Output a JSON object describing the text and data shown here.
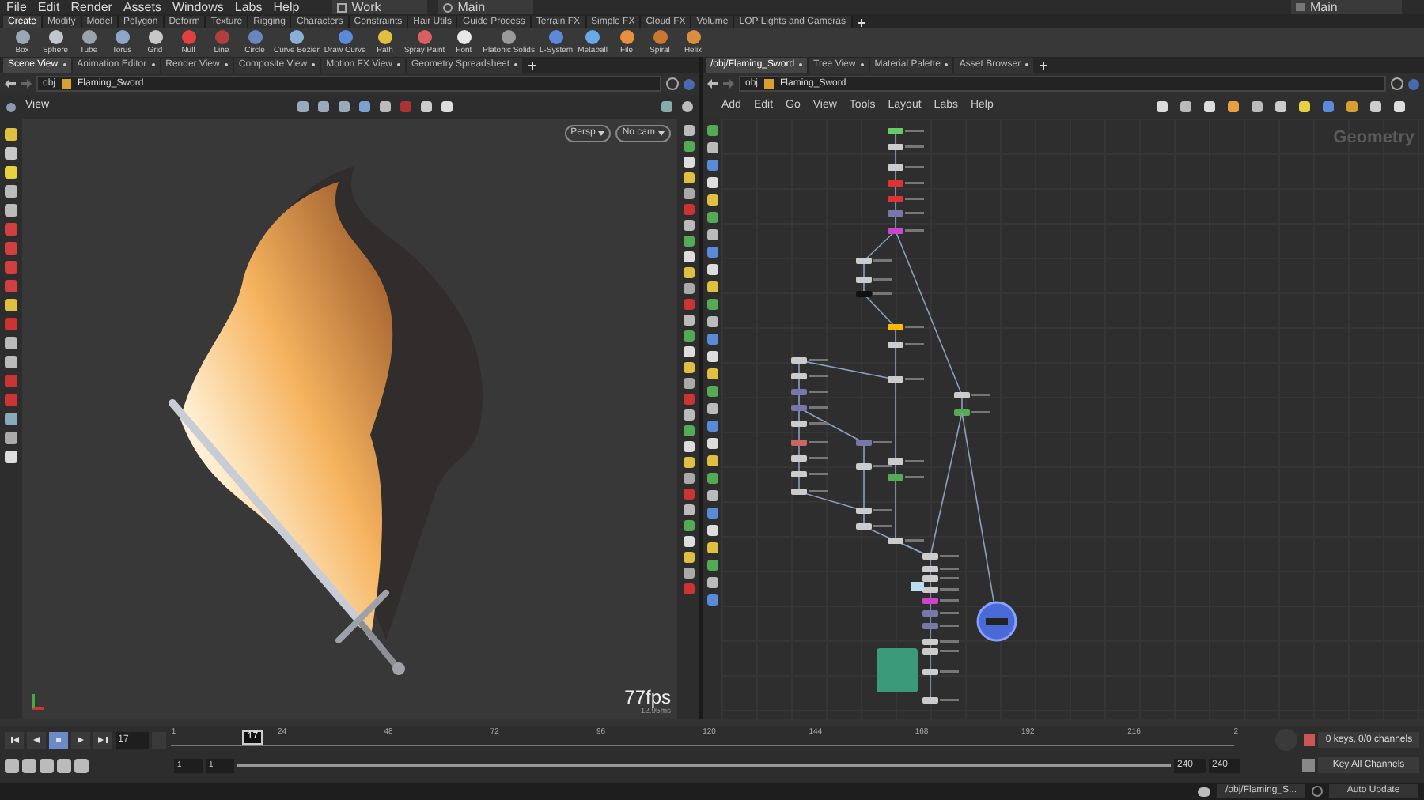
{
  "menu": [
    "File",
    "Edit",
    "Render",
    "Assets",
    "Windows",
    "Labs",
    "Help"
  ],
  "desktop": "Work",
  "main_left": "Main",
  "main_right": "Main",
  "shelf_tabs": [
    {
      "label": "Create",
      "selected": true
    },
    {
      "label": "Modify",
      "selected": false
    },
    {
      "label": "Model",
      "selected": false
    },
    {
      "label": "Polygon",
      "selected": false
    },
    {
      "label": "Deform",
      "selected": false
    },
    {
      "label": "Texture",
      "selected": false
    },
    {
      "label": "Rigging",
      "selected": false
    },
    {
      "label": "Characters",
      "selected": false
    },
    {
      "label": "Constraints",
      "selected": false
    },
    {
      "label": "Hair Utils",
      "selected": false
    },
    {
      "label": "Guide Process",
      "selected": false
    },
    {
      "label": "Terrain FX",
      "selected": false
    },
    {
      "label": "Simple FX",
      "selected": false
    },
    {
      "label": "Cloud FX",
      "selected": false
    },
    {
      "label": "Volume",
      "selected": false
    },
    {
      "label": "LOP Lights and Cameras",
      "selected": false
    }
  ],
  "shelf_tools": [
    "Box",
    "Sphere",
    "Tube",
    "Torus",
    "Grid",
    "Null",
    "Line",
    "Circle",
    "Curve Bezier",
    "Draw Curve",
    "Path",
    "Spray Paint",
    "Font",
    "Platonic Solids",
    "L-System",
    "Metaball",
    "File",
    "Spiral",
    "Helix"
  ],
  "left_pane": {
    "tabs": [
      {
        "label": "Scene View",
        "selected": true
      },
      {
        "label": "Animation Editor",
        "selected": false
      },
      {
        "label": "Render View",
        "selected": false
      },
      {
        "label": "Composite View",
        "selected": false
      },
      {
        "label": "Motion FX View",
        "selected": false
      },
      {
        "label": "Geometry Spreadsheet",
        "selected": false
      }
    ],
    "path": [
      "obj",
      "Flaming_Sword"
    ],
    "view_label": "View",
    "camera_menus": [
      "Persp",
      "No cam"
    ],
    "fps": "77fps",
    "frame_time": "12.95ms"
  },
  "right_pane": {
    "tabs": [
      {
        "label": "/obj/Flaming_Sword",
        "selected": true
      },
      {
        "label": "Tree View",
        "selected": false
      },
      {
        "label": "Material Palette",
        "selected": false
      },
      {
        "label": "Asset Browser",
        "selected": false
      }
    ],
    "path": [
      "obj",
      "Flaming_Sword"
    ],
    "menu": [
      "Add",
      "Edit",
      "Go",
      "View",
      "Tools",
      "Layout",
      "Labs",
      "Help"
    ],
    "context_label": "Geometry"
  },
  "timeline": {
    "frame": "17",
    "playhead": {
      "label": "17",
      "level": 0.067
    },
    "range": {
      "level": 1
    },
    "ticks": [
      "1",
      "24",
      "48",
      "72",
      "96",
      "120",
      "144",
      "168",
      "192",
      "216",
      "2"
    ],
    "range_start": [
      "1",
      "1"
    ],
    "range_end": [
      "240",
      "240"
    ],
    "keys_info": "0 keys, 0/0 channels",
    "key_mode": "Key All Channels"
  },
  "status_bar": {
    "path": "/obj/Flaming_S...",
    "update_mode": "Auto Update"
  }
}
